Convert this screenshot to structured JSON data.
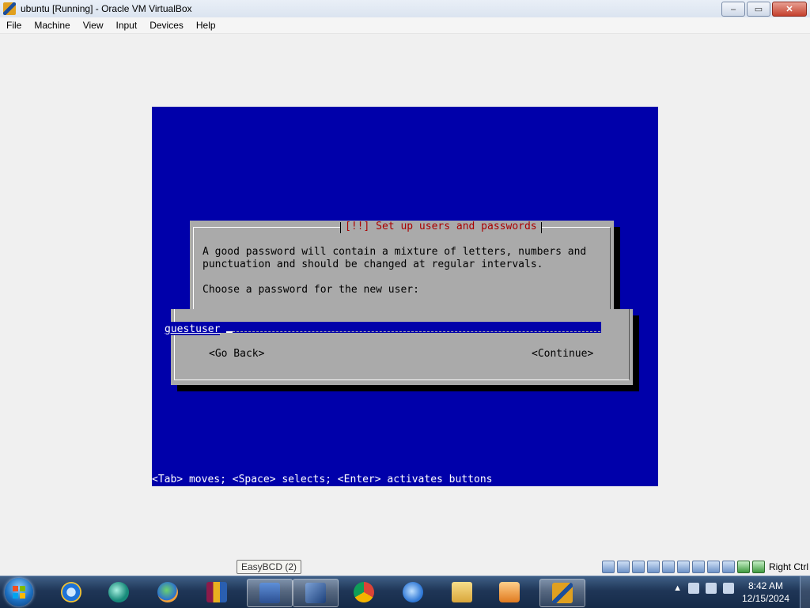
{
  "window": {
    "title": "ubuntu [Running] - Oracle VM VirtualBox",
    "controls": [
      "–",
      "▭",
      "✕"
    ]
  },
  "menubar": {
    "items": [
      "File",
      "Machine",
      "View",
      "Input",
      "Devices",
      "Help"
    ]
  },
  "installer": {
    "dialog_title": "[!!] Set up users and passwords",
    "line1": "A good password will contain a mixture of letters, numbers and",
    "line2": "punctuation and should be changed at regular intervals.",
    "prompt": "Choose a password for the new user:",
    "password_value": "guestuser",
    "go_back": "<Go Back>",
    "continue": "<Continue>",
    "status_line": "<Tab> moves; <Space> selects; <Enter> activates buttons",
    "colors": {
      "screen": "#0000aa",
      "dialog": "#aaaaaa",
      "title": "#aa0000"
    }
  },
  "tooltip": {
    "text": "EasyBCD (2)"
  },
  "vbox_status": {
    "icons": [
      "hard-disk-icon",
      "optical-drive-icon",
      "audio-icon",
      "network-icon",
      "usb-icon",
      "shared-folder-icon",
      "display-icon",
      "recording-icon",
      "cpu-virtualization-icon",
      "mouse-integration-icon",
      "keyboard-icon"
    ],
    "host_key": "Right Ctrl"
  },
  "taskbar": {
    "apps": [
      "internet-explorer-icon",
      "app-icon",
      "network-globe-icon",
      "winrar-icon",
      "easybcd-icon",
      "virtualbox-icon",
      "chrome-icon",
      "browser-icon",
      "file-explorer-icon",
      "media-player-icon",
      "virtualbox-vm-icon"
    ],
    "clock_time": "8:42 AM",
    "clock_date": "12/15/2024",
    "tray_arrow": "▲"
  }
}
